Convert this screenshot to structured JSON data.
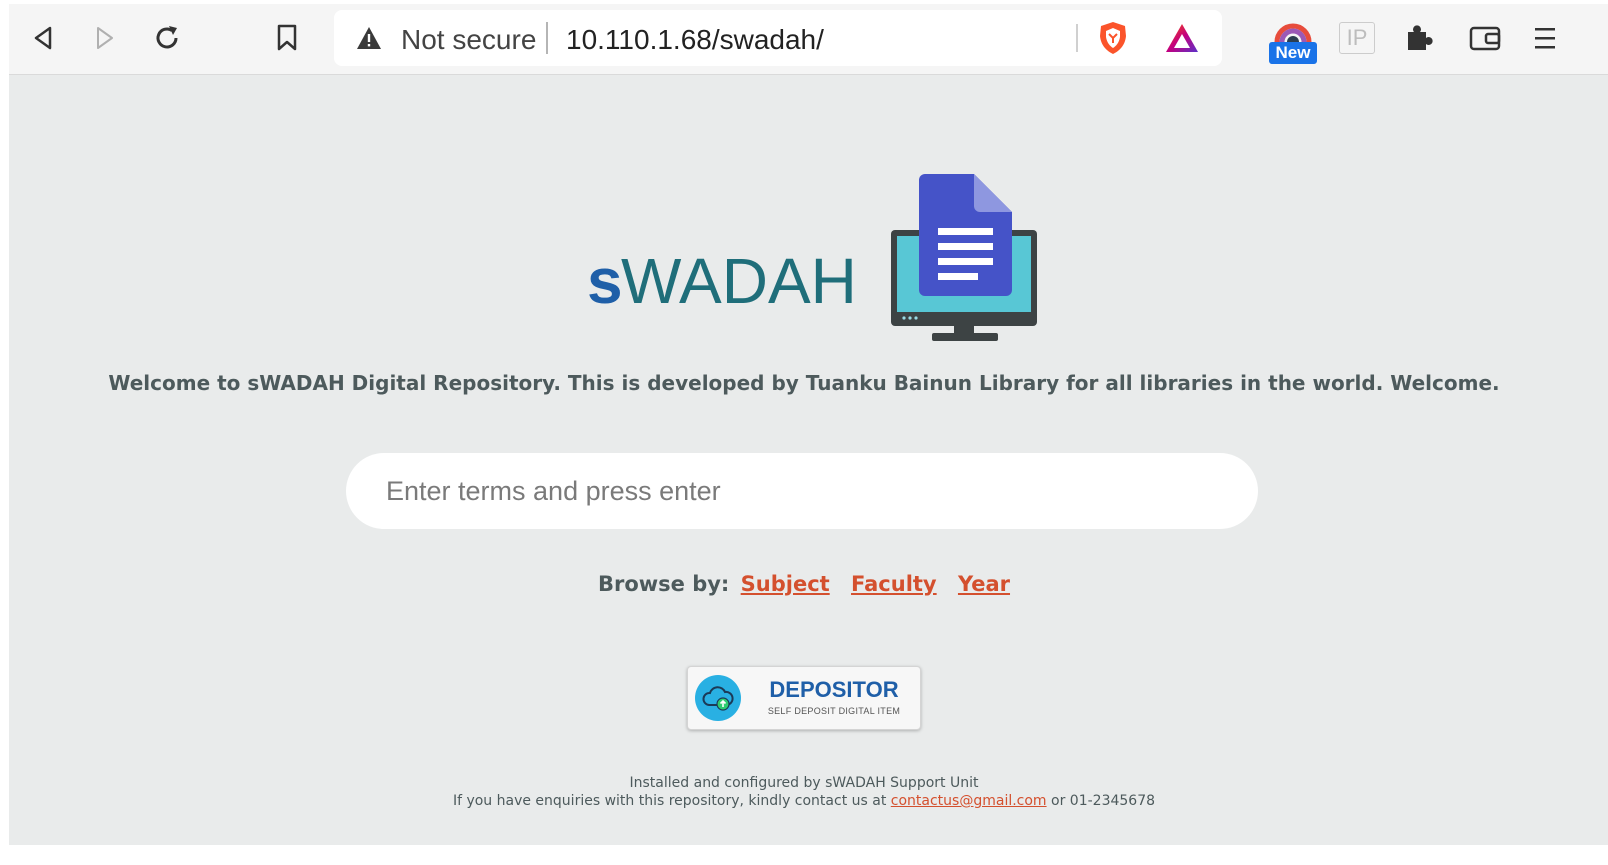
{
  "browser": {
    "security_label": "Not secure",
    "url": "10.110.1.68/swadah/",
    "extension_badge": "New",
    "ip_extension_label": "IP"
  },
  "site": {
    "logo_text_s": "s",
    "logo_text_rest": "WADAH",
    "welcome": "Welcome to sWADAH Digital Repository. This is developed by Tuanku Bainun Library for all libraries in the world. Welcome.",
    "search_placeholder": "Enter terms and press enter",
    "browse_label": "Browse by:",
    "browse_links": [
      "Subject",
      "Faculty",
      "Year"
    ],
    "depositor": {
      "title": "DEPOSITOR",
      "subtitle": "SELF DEPOSIT DIGITAL ITEM"
    },
    "footer": {
      "line1": "Installed and configured by sWADAH Support Unit",
      "line2_prefix": "If you have enquiries with this repository, kindly contact us at",
      "email": "contactus@gmail.com",
      "line2_suffix": "or 01-2345678"
    }
  },
  "colors": {
    "page_bg": "#e9ebeb",
    "link": "#d4502e",
    "logo_blue": "#1f5fa8",
    "logo_teal": "#1f6e7a",
    "doc_blue": "#4553c8",
    "screen_cyan": "#58c7d5"
  }
}
